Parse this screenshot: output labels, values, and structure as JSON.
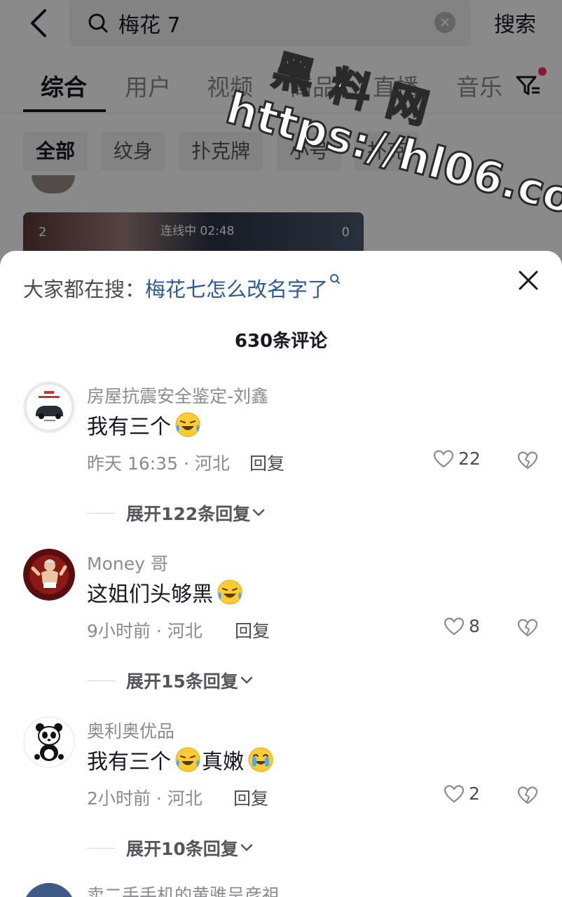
{
  "search": {
    "query": "梅花 7",
    "submit_label": "搜索"
  },
  "tabs": [
    {
      "label": "综合",
      "active": true
    },
    {
      "label": "用户"
    },
    {
      "label": "视频"
    },
    {
      "label": "商品"
    },
    {
      "label": "直播"
    },
    {
      "label": "音乐"
    }
  ],
  "chips": [
    {
      "label": "全部",
      "active": true
    },
    {
      "label": "纹身"
    },
    {
      "label": "扑克牌"
    },
    {
      "label": "小号"
    },
    {
      "label": "扑克"
    }
  ],
  "video_card": {
    "left_count": "2",
    "live_label": "连线中 02:48",
    "right_count": "0"
  },
  "watermark": {
    "line1": "黑料网",
    "line2": "https://hl06.co"
  },
  "comments_sheet": {
    "suggest_label": "大家都在搜：",
    "suggest_query": "梅花七怎么改名字了",
    "count_label": "630条评论",
    "comments": [
      {
        "author": "房屋抗震安全鉴定-刘鑫",
        "text": "我有三个",
        "emojis": [
          "laughing-crying"
        ],
        "meta": "昨天 16:35 · 河北",
        "reply_label": "回复",
        "likes": "22",
        "expand_label": "展开122条回复"
      },
      {
        "author": "Money 哥",
        "text": "这姐们头够黑",
        "emojis": [
          "laughing-crying"
        ],
        "meta": "9小时前 · 河北",
        "reply_label": "回复",
        "likes": "8",
        "expand_label": "展开15条回复"
      },
      {
        "author": "奥利奥优品",
        "text": "我有三个",
        "text_after": "真嫩",
        "emojis": [
          "laughing-crying",
          "tears-of-joy"
        ],
        "meta": "2小时前 · 河北",
        "reply_label": "回复",
        "likes": "2",
        "expand_label": "展开10条回复"
      }
    ],
    "next_author_partial": "卖二手手机的黄骓呈彦祖"
  },
  "colors": {
    "link_blue": "#2c5a9b",
    "notification_red": "#fe2c55",
    "text_primary": "#161823",
    "text_secondary": "#8a8b91"
  }
}
